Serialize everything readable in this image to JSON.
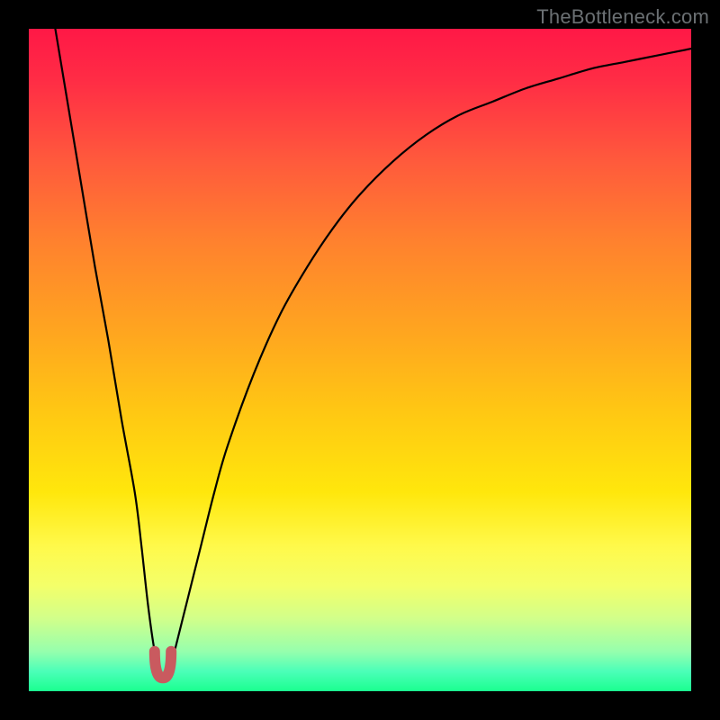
{
  "watermark": "TheBottleneck.com",
  "chart_data": {
    "type": "line",
    "title": "",
    "xlabel": "",
    "ylabel": "",
    "xlim": [
      0,
      100
    ],
    "ylim": [
      0,
      100
    ],
    "grid": false,
    "series": [
      {
        "name": "bottleneck-curve",
        "x": [
          4,
          6,
          8,
          10,
          12,
          14,
          16,
          17,
          18,
          19,
          20,
          21,
          22,
          24,
          26,
          28,
          30,
          34,
          38,
          42,
          46,
          50,
          55,
          60,
          65,
          70,
          75,
          80,
          85,
          90,
          95,
          100
        ],
        "y": [
          100,
          88,
          76,
          64,
          53,
          41,
          30,
          22,
          13,
          6,
          2,
          2,
          6,
          14,
          22,
          30,
          37,
          48,
          57,
          64,
          70,
          75,
          80,
          84,
          87,
          89,
          91,
          92.5,
          94,
          95,
          96,
          97
        ]
      }
    ],
    "annotations": [
      {
        "name": "minimum-marker",
        "shape": "u",
        "color": "#c95a5f",
        "x_range": [
          19,
          21.5
        ],
        "y_range": [
          2,
          6
        ]
      }
    ]
  }
}
